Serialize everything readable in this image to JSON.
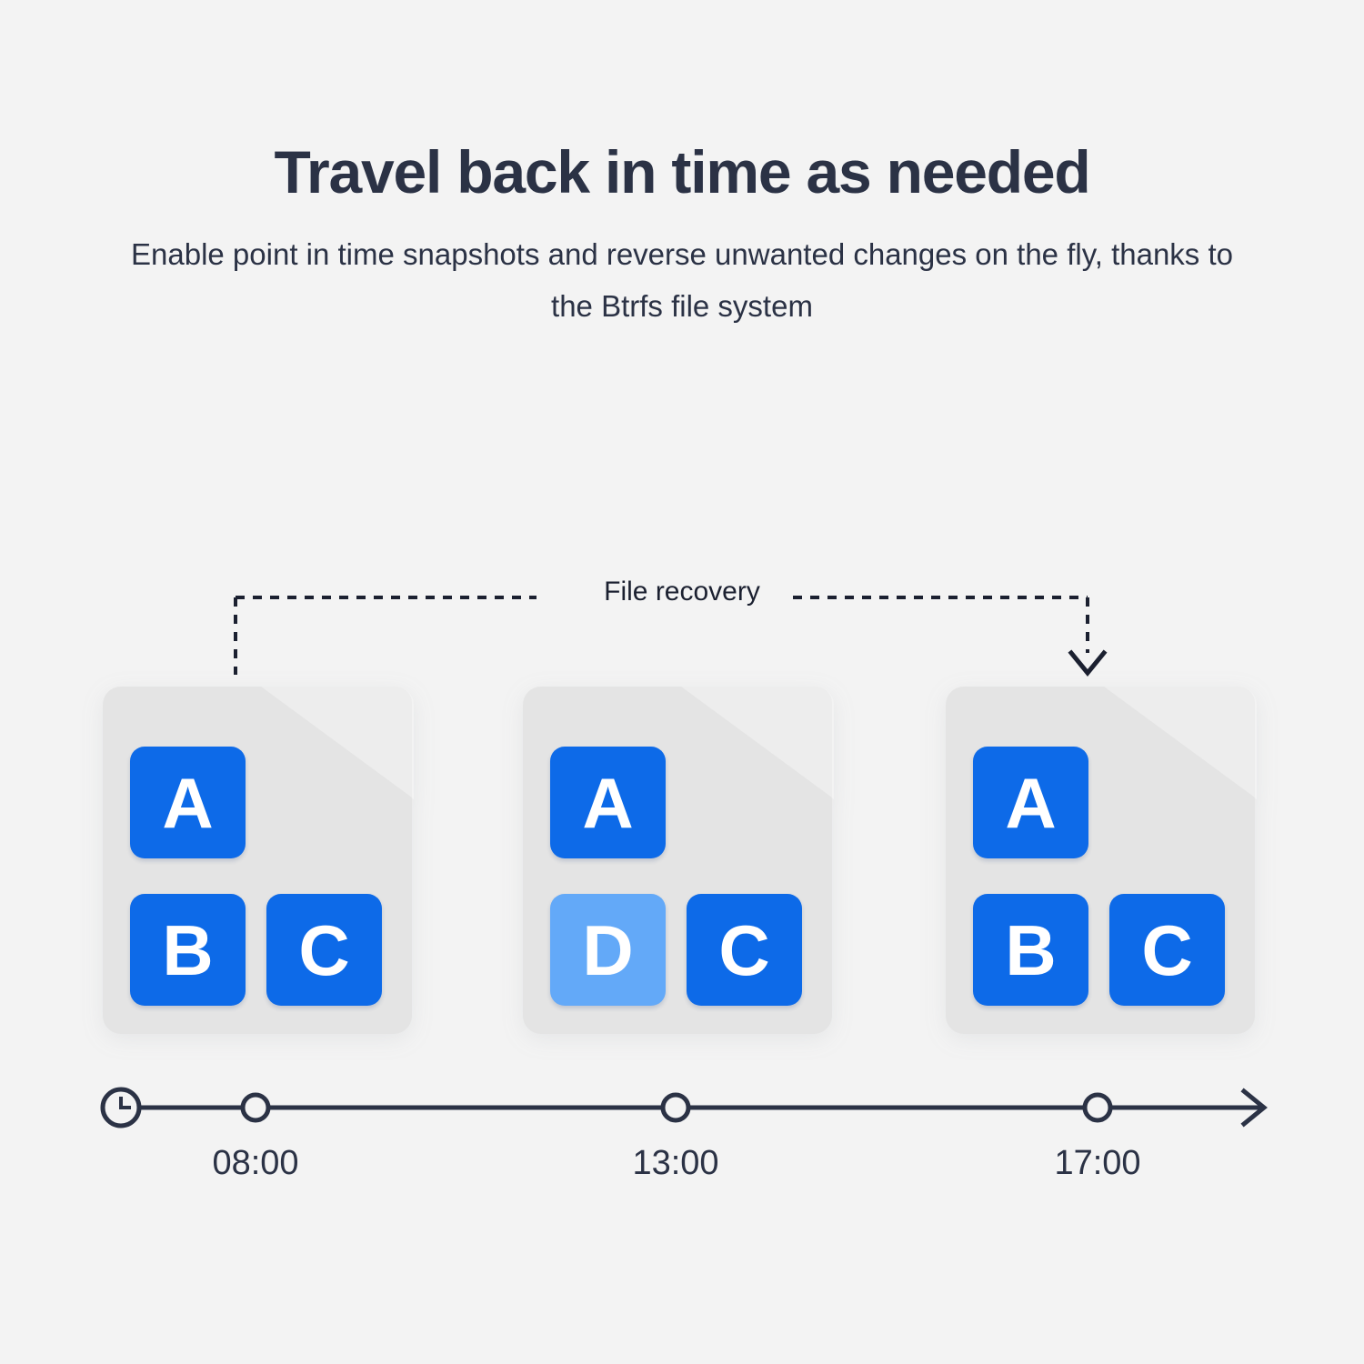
{
  "header": {
    "title": "Travel back in time as needed",
    "subtitle": "Enable point in time snapshots and reverse unwanted changes on the fly, thanks to the Btrfs file system"
  },
  "diagram": {
    "recovery_label": "File recovery",
    "colors": {
      "background": "#f3f3f3",
      "card_body": "#e4e4e4",
      "card_fold": "#ededed",
      "tile_blue": "#0d6ae8",
      "tile_light_blue": "#63a9f8",
      "ink": "#2b3245"
    },
    "snapshots": [
      {
        "time": "08:00",
        "marker": "circle",
        "tiles": [
          {
            "letter": "A",
            "state": "normal"
          },
          {
            "letter": "B",
            "state": "normal"
          },
          {
            "letter": "C",
            "state": "normal"
          }
        ]
      },
      {
        "time": "13:00",
        "marker": "circle",
        "tiles": [
          {
            "letter": "A",
            "state": "normal"
          },
          {
            "letter": "D",
            "state": "changed"
          },
          {
            "letter": "C",
            "state": "normal"
          }
        ]
      },
      {
        "time": "17:00",
        "marker": "circle",
        "tiles": [
          {
            "letter": "A",
            "state": "normal"
          },
          {
            "letter": "B",
            "state": "normal"
          },
          {
            "letter": "C",
            "state": "normal"
          }
        ]
      }
    ],
    "timeline": {
      "start_icon": "clock-icon",
      "end_icon": "arrow-right-icon"
    }
  }
}
